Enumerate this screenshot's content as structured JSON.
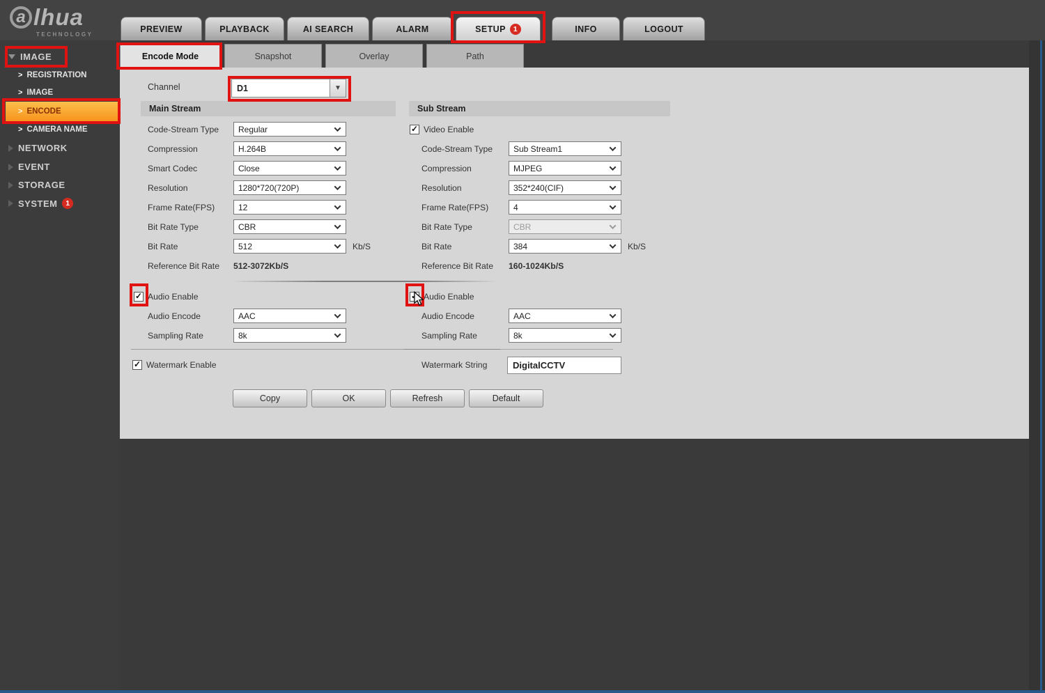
{
  "logo": {
    "brand_first": "a",
    "brand_rest": "lhua",
    "tagline": "TECHNOLOGY"
  },
  "nav": {
    "items": [
      {
        "label": "PREVIEW"
      },
      {
        "label": "PLAYBACK"
      },
      {
        "label": "AI SEARCH"
      },
      {
        "label": "ALARM"
      },
      {
        "label": "SETUP",
        "badge": "1"
      },
      {
        "label": "INFO"
      },
      {
        "label": "LOGOUT"
      }
    ]
  },
  "sidebar": {
    "image_group_label": "IMAGE",
    "image_items": [
      {
        "label": "REGISTRATION"
      },
      {
        "label": "IMAGE"
      },
      {
        "label": "ENCODE"
      },
      {
        "label": "CAMERA NAME"
      }
    ],
    "groups": [
      {
        "label": "NETWORK"
      },
      {
        "label": "EVENT"
      },
      {
        "label": "STORAGE"
      },
      {
        "label": "SYSTEM",
        "badge": "1"
      }
    ]
  },
  "subtabs": [
    {
      "label": "Encode Mode"
    },
    {
      "label": "Snapshot"
    },
    {
      "label": "Overlay"
    },
    {
      "label": "Path"
    }
  ],
  "form": {
    "channel_label": "Channel",
    "channel_value": "D1",
    "main_stream": {
      "title": "Main Stream",
      "fields": [
        {
          "label": "Code-Stream Type",
          "value": "Regular"
        },
        {
          "label": "Compression",
          "value": "H.264B"
        },
        {
          "label": "Smart Codec",
          "value": "Close"
        },
        {
          "label": "Resolution",
          "value": "1280*720(720P)"
        },
        {
          "label": "Frame Rate(FPS)",
          "value": "12"
        },
        {
          "label": "Bit Rate Type",
          "value": "CBR"
        },
        {
          "label": "Bit Rate",
          "value": "512",
          "unit": "Kb/S"
        }
      ],
      "reference_label": "Reference Bit Rate",
      "reference_value": "512-3072Kb/S",
      "audio": {
        "enable_label": "Audio Enable",
        "encode_label": "Audio Encode",
        "encode_value": "AAC",
        "sampling_label": "Sampling Rate",
        "sampling_value": "8k"
      }
    },
    "sub_stream": {
      "title": "Sub Stream",
      "video_enable_label": "Video Enable",
      "fields": [
        {
          "label": "Code-Stream Type",
          "value": "Sub Stream1"
        },
        {
          "label": "Compression",
          "value": "MJPEG"
        },
        {
          "label": "Resolution",
          "value": "352*240(CIF)"
        },
        {
          "label": "Frame Rate(FPS)",
          "value": "4"
        },
        {
          "label": "Bit Rate Type",
          "value": "CBR"
        },
        {
          "label": "Bit Rate",
          "value": "384",
          "unit": "Kb/S"
        }
      ],
      "reference_label": "Reference Bit Rate",
      "reference_value": "160-1024Kb/S",
      "audio": {
        "enable_label": "Audio Enable",
        "encode_label": "Audio Encode",
        "encode_value": "AAC",
        "sampling_label": "Sampling Rate",
        "sampling_value": "8k"
      }
    },
    "watermark": {
      "enable_label": "Watermark Enable",
      "string_label": "Watermark String",
      "string_value": "DigitalCCTV"
    },
    "buttons": [
      {
        "label": "Copy"
      },
      {
        "label": "OK"
      },
      {
        "label": "Refresh"
      },
      {
        "label": "Default"
      }
    ]
  },
  "colors": {
    "accent_orange": "#f7941e",
    "annotation_red": "#e01212",
    "badge_red": "#d62b20",
    "edge_blue": "#27598a"
  }
}
